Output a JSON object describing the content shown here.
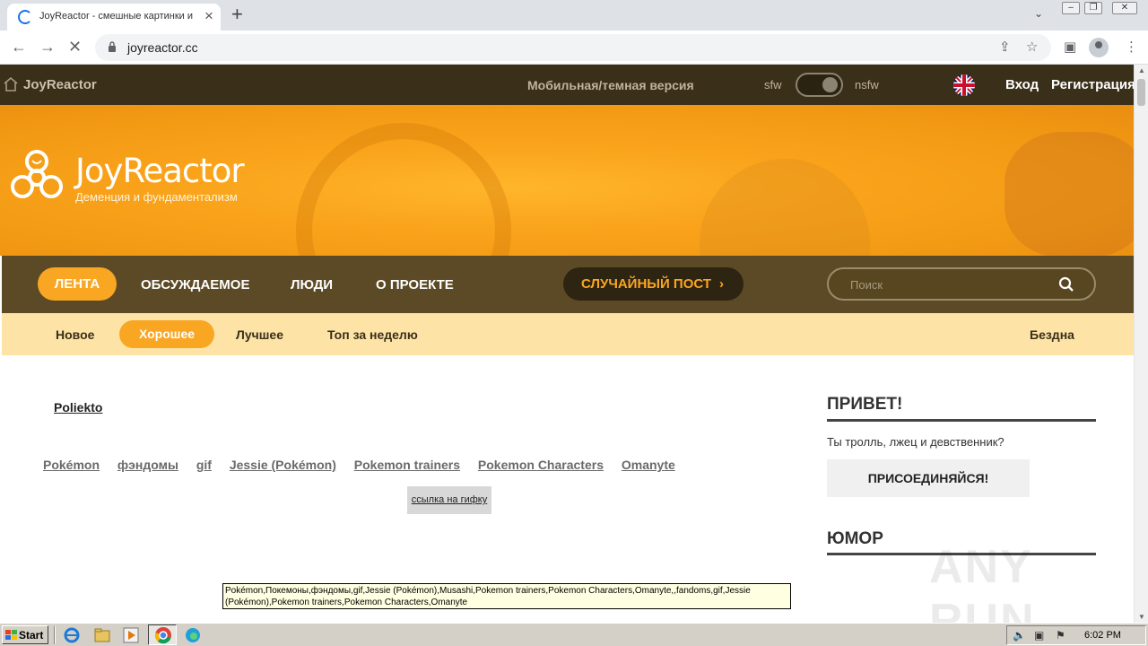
{
  "browser": {
    "tab_title": "JoyReactor - смешные картинки и",
    "tab_close": "×",
    "new_tab": "+",
    "url": "joyreactor.cc",
    "icons": [
      "back-icon",
      "forward-icon",
      "stop-icon",
      "lock-icon",
      "share-icon",
      "star-icon",
      "sidepanel-icon",
      "profile-icon",
      "menu-icon"
    ]
  },
  "site_header": {
    "brand": "JoyReactor",
    "mobile_link": "Мобильная/темная версия",
    "sfw": "sfw",
    "nsfw": "nsfw",
    "login": "Вход",
    "register": "Регистрация"
  },
  "banner": {
    "title": "JoyReactor",
    "subtitle": "Деменция и фундаментализм"
  },
  "main_nav": {
    "items": [
      "ЛЕНТА",
      "ОБСУЖДАЕМОЕ",
      "ЛЮДИ",
      "О ПРОЕКТЕ"
    ],
    "active_index": 0,
    "random_post": "СЛУЧАЙНЫЙ ПОСТ",
    "random_chevron": "›",
    "search_placeholder": "Поиск"
  },
  "sub_nav": {
    "items": [
      "Новое",
      "Хорошее",
      "Лучшее",
      "Топ за неделю"
    ],
    "active_index": 1,
    "abyss": "Бездна"
  },
  "post": {
    "author": "Poliekto",
    "tags": [
      "Pokémon",
      "фэндомы",
      "gif",
      "Jessie (Pokémon)",
      "Pokemon trainers",
      "Pokemon Characters",
      "Omanyte"
    ],
    "gif_link": "ссылка на гифку",
    "tooltip": "Pokémon,Покемоны,фэндомы,gif,Jessie (Pokémon),Musashi,Pokemon trainers,Pokemon Characters,Omanyte,,fandoms,gif,Jessie (Pokémon),Pokemon trainers,Pokemon Characters,Omanyte"
  },
  "sidebar": {
    "hello": "ПРИВЕТ!",
    "text": "Ты тролль, лжец и девственник?",
    "join": "ПРИСОЕДИНЯЙСЯ!",
    "humor": "ЮМОР"
  },
  "watermark": "ANY RUN",
  "taskbar": {
    "start": "Start",
    "clock": "6:02 PM"
  },
  "colors": {
    "accent": "#f9a622",
    "header_dark": "#3a2f19",
    "nav_brown": "#5b4a25",
    "subnav": "#fde3a6"
  }
}
